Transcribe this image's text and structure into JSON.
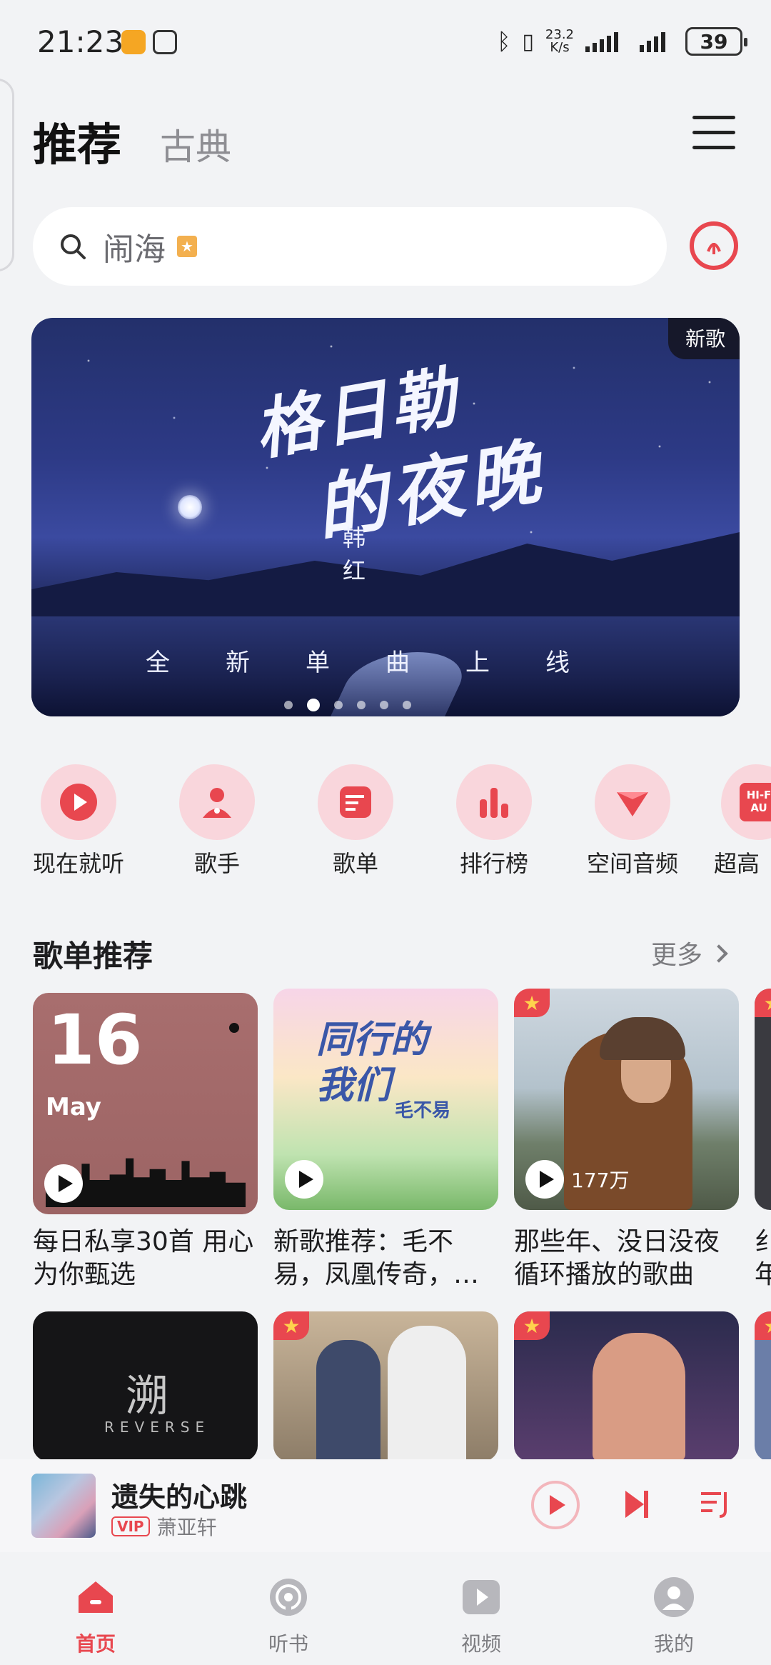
{
  "status_bar": {
    "time": "21:23",
    "net_speed_value": "23.2",
    "net_speed_unit": "K/s",
    "battery": "39"
  },
  "header": {
    "tab_active": "推荐",
    "tab_other": "古典",
    "menu_icon": "menu-icon"
  },
  "search": {
    "placeholder": "闹海",
    "voice_icon": "voice-recognition-icon"
  },
  "banner": {
    "tag": "新歌",
    "title_line1": "格日勒",
    "title_line2": "的夜晚",
    "artist": "韩红",
    "subtitle": "全新单曲上线",
    "page_index": 1,
    "page_count": 6
  },
  "shortcuts": [
    {
      "label": "现在就听",
      "icon": "play-circle-icon"
    },
    {
      "label": "歌手",
      "icon": "singer-icon"
    },
    {
      "label": "歌单",
      "icon": "playlist-icon"
    },
    {
      "label": "排行榜",
      "icon": "chart-bars-icon"
    },
    {
      "label": "空间音频",
      "icon": "spatial-audio-icon"
    },
    {
      "label": "超高",
      "icon": "hifi-audio-icon",
      "badge": "HI-F AU"
    }
  ],
  "section": {
    "title": "歌单推荐",
    "more": "更多"
  },
  "playlists": [
    {
      "title": "每日私享30首 用心为你甄选",
      "date_day": "16",
      "date_month": "May",
      "plays": ""
    },
    {
      "title": "新歌推荐：毛不易，凤凰传奇，…",
      "cover_text": "同行的我们",
      "cover_artist": "毛不易",
      "plays": ""
    },
    {
      "title": "那些年、没日没夜循环播放的歌曲",
      "plays": "177万"
    },
    {
      "title": "纟年",
      "plays": ""
    }
  ],
  "playlists_row2": [
    {
      "cover_text": "溯",
      "cover_sub": "REVERSE"
    },
    {
      "cover_text": ""
    },
    {
      "cover_text": ""
    }
  ],
  "mini_player": {
    "song": "遗失的心跳",
    "vip_badge": "VIP",
    "artist": "萧亚轩"
  },
  "bottom_nav": [
    {
      "label": "首页",
      "icon": "home-icon",
      "active": true
    },
    {
      "label": "听书",
      "icon": "audiobook-icon",
      "active": false
    },
    {
      "label": "视频",
      "icon": "video-icon",
      "active": false
    },
    {
      "label": "我的",
      "icon": "profile-icon",
      "active": false
    }
  ],
  "colors": {
    "accent": "#e8474f",
    "background": "#f2f3f5",
    "shortcut_blob": "#f9d6dc"
  }
}
